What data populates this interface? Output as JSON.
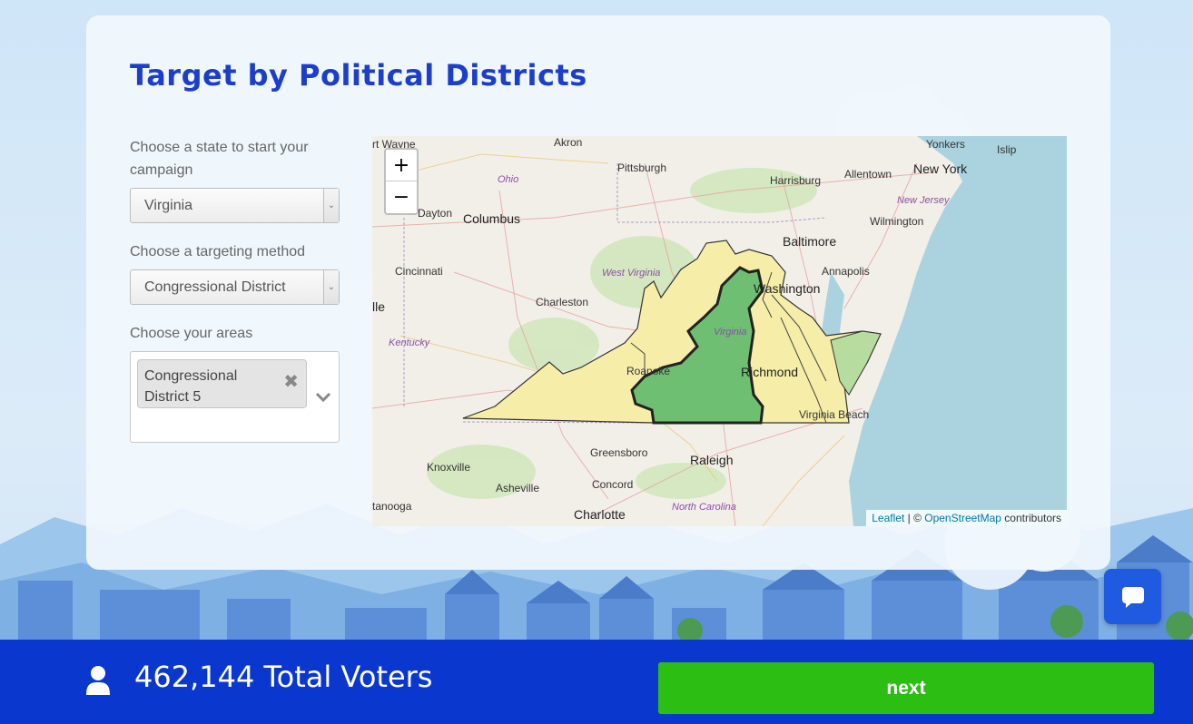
{
  "page": {
    "title": "Target by Political Districts"
  },
  "form": {
    "state_label": "Choose a state to start your campaign",
    "state_value": "Virginia",
    "method_label": "Choose a targeting method",
    "method_value": "Congressional District",
    "areas_label": "Choose your areas",
    "selected_areas": [
      "Congressional District 5"
    ]
  },
  "map": {
    "zoom_in": "+",
    "zoom_out": "−",
    "attribution": {
      "leaflet": "Leaflet",
      "sep": " | © ",
      "osm": "OpenStreetMap",
      "suffix": " contributors"
    },
    "places": {
      "fort_wayne": "rt Wayne",
      "akron": "Akron",
      "pittsburgh": "Pittsburgh",
      "harrisburg": "Harrisburg",
      "allentown": "Allentown",
      "yonkers": "Yonkers",
      "islip": "Islip",
      "new_york": "New York",
      "ohio": "Ohio",
      "dayton": "Dayton",
      "columbus": "Columbus",
      "new_jersey": "New Jersey",
      "wilmington": "Wilmington",
      "baltimore": "Baltimore",
      "cincinnati": "Cincinnati",
      "west_virginia": "West Virginia",
      "annapolis": "Annapolis",
      "washington": "Washington",
      "lle": "lle",
      "charleston": "Charleston",
      "kentucky": "Kentucky",
      "virginia": "Virginia",
      "roanoke": "Roanoke",
      "richmond": "Richmond",
      "virginia_beach": "Virginia Beach",
      "greensboro": "Greensboro",
      "raleigh": "Raleigh",
      "knoxville": "Knoxville",
      "asheville": "Asheville",
      "concord": "Concord",
      "north_carolina": "North Carolina",
      "chattanooga": "tanooga",
      "charlotte": "Charlotte"
    }
  },
  "footer": {
    "total_voters": "462,144 Total Voters",
    "next_label": "next"
  },
  "colors": {
    "accent": "#1d3ec9",
    "footer": "#0a38cf",
    "next": "#2dbe14",
    "district_fill": "#6fbf73",
    "state_fill": "#f6eea8"
  }
}
